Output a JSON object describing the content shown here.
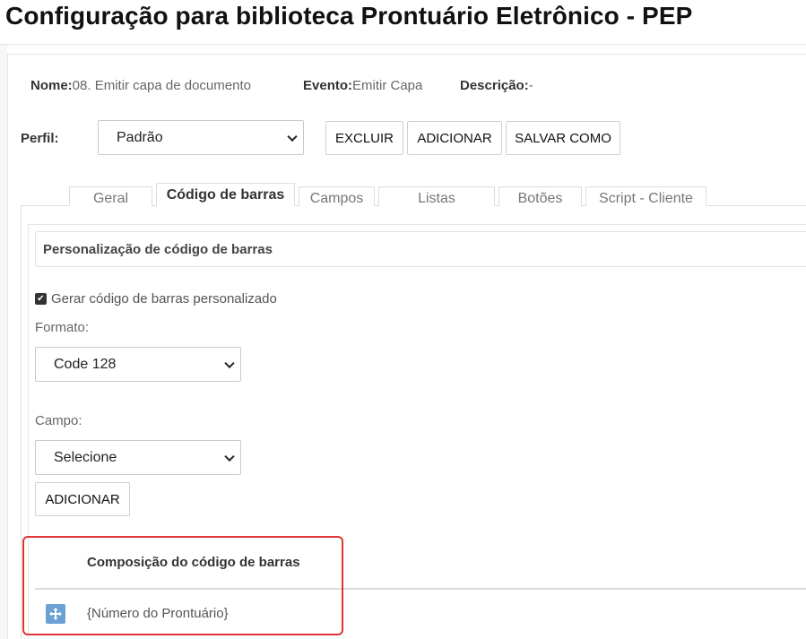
{
  "page": {
    "title": "Configuração para biblioteca Prontuário Eletrônico - PEP"
  },
  "meta": {
    "nome_label": "Nome:",
    "nome_value": "08. Emitir capa de documento",
    "evento_label": "Evento:",
    "evento_value": "Emitir Capa",
    "descricao_label": "Descrição:",
    "descricao_value": "-"
  },
  "perfil": {
    "label": "Perfil:",
    "selected": "Padrão"
  },
  "toolbar": {
    "excluir": "EXCLUIR",
    "adicionar": "ADICIONAR",
    "salvar_como": "SALVAR COMO"
  },
  "tabs": [
    {
      "label": "Geral",
      "active": false
    },
    {
      "label": "Código de barras",
      "active": true
    },
    {
      "label": "Campos",
      "active": false
    },
    {
      "label": "Listas",
      "active": false
    },
    {
      "label": "Botões",
      "active": false
    },
    {
      "label": "Script - Cliente",
      "active": false
    }
  ],
  "barcode": {
    "section_title": "Personalização de código de barras",
    "custom_checkbox_label": "Gerar código de barras personalizado",
    "custom_checked": true,
    "formato_label": "Formato:",
    "formato_selected": "Code 128",
    "campo_label": "Campo:",
    "campo_selected": "Selecione",
    "add_button": "ADICIONAR"
  },
  "composition": {
    "title": "Composição do código de barras",
    "items": [
      "{Número do Prontuário}"
    ],
    "highlight_color": "#e03333"
  },
  "icons": {
    "move": "move-arrows-icon",
    "checkbox": "checkmark-icon",
    "select": "chevron-down-icon"
  }
}
